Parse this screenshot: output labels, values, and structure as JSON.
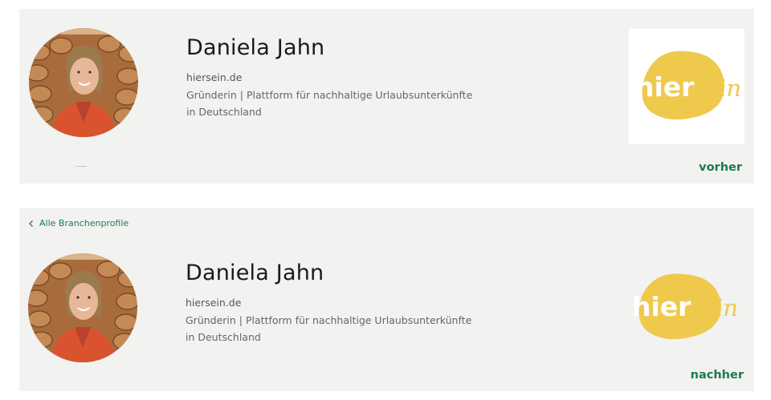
{
  "colors": {
    "card_bg": "#f2f2f1",
    "accent_green": "#1d7a52",
    "logo_yellow": "#efc94c"
  },
  "before": {
    "name": "Daniela Jahn",
    "website": "hiersein.de",
    "description": "Gründerin | Plattform für nachhaltige Urlaubsunterkünfte in Deutschland",
    "label": "vorher",
    "logo_text": "hiersein"
  },
  "after": {
    "back_link": "Alle Branchenprofile",
    "back_icon": "chevron-left-icon",
    "name": "Daniela Jahn",
    "website": "hiersein.de",
    "description": "Gründerin | Plattform für nachhaltige Urlaubsunterkünfte in Deutschland",
    "label": "nachher",
    "logo_text": "hiersein"
  }
}
